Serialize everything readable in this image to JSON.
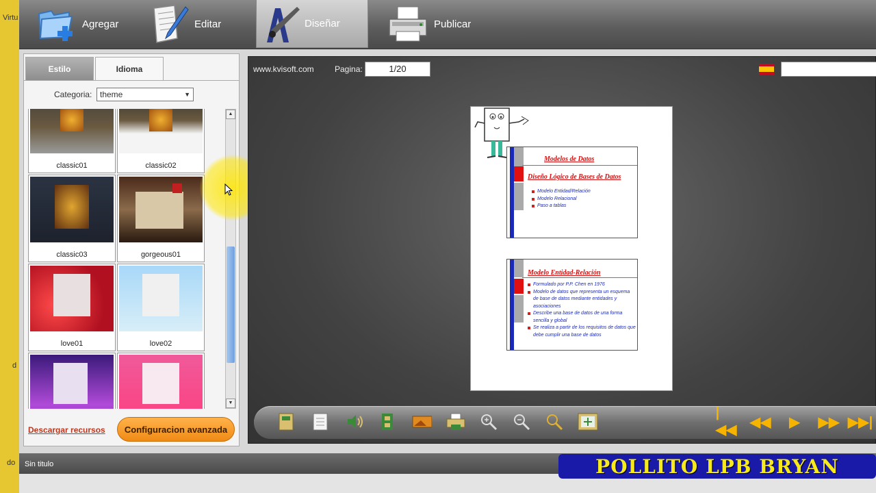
{
  "window_fragments": [
    "Virtu",
    "d",
    "do"
  ],
  "toolbar": {
    "buttons": [
      {
        "label": "Agregar",
        "icon": "folder-add-icon"
      },
      {
        "label": "Editar",
        "icon": "document-edit-icon"
      },
      {
        "label": "Diseñar",
        "icon": "design-brush-icon"
      },
      {
        "label": "Publicar",
        "icon": "printer-publish-icon"
      }
    ],
    "active": "Diseñar"
  },
  "left_panel": {
    "tabs": [
      "Estilo",
      "Idioma"
    ],
    "category_label": "Categoria:",
    "category_value": "theme",
    "themes": [
      "classic01",
      "classic02",
      "classic03",
      "gorgeous01",
      "love01",
      "love02",
      "",
      ""
    ],
    "download_link": "Descargar recursos",
    "advanced_button": "Configuracion avanzada"
  },
  "preview": {
    "site": "www.kvisoft.com",
    "page_label": "Pagina:",
    "page_value": "1/20",
    "slide1": {
      "title": "Modelos de Datos",
      "subtitle": "Diseño Lógico de Bases de Datos",
      "bullets": [
        "Modelo Entidad/Relación",
        "Modelo Relacional",
        "Paso a tablas"
      ]
    },
    "slide2": {
      "title": "Modelo Entidad-Relación",
      "bullets": [
        "Formulado por P.P. Chen en 1976",
        "Modelo de datos que representa un esquema de base de datos mediante entidades y asociaciones",
        "Describe una base de datos de una forma sencilla y global",
        "Se realiza a partir de los requisitos de datos que debe cumplir una base de datos"
      ]
    }
  },
  "status": {
    "text": "Sin titulo"
  },
  "watermark": "POLLITO LPB BRYAN",
  "colors": {
    "accent_orange": "#f08b16",
    "link_red": "#b9381f",
    "watermark_bg": "#1a1aa8",
    "watermark_text": "#f6ea1c"
  }
}
